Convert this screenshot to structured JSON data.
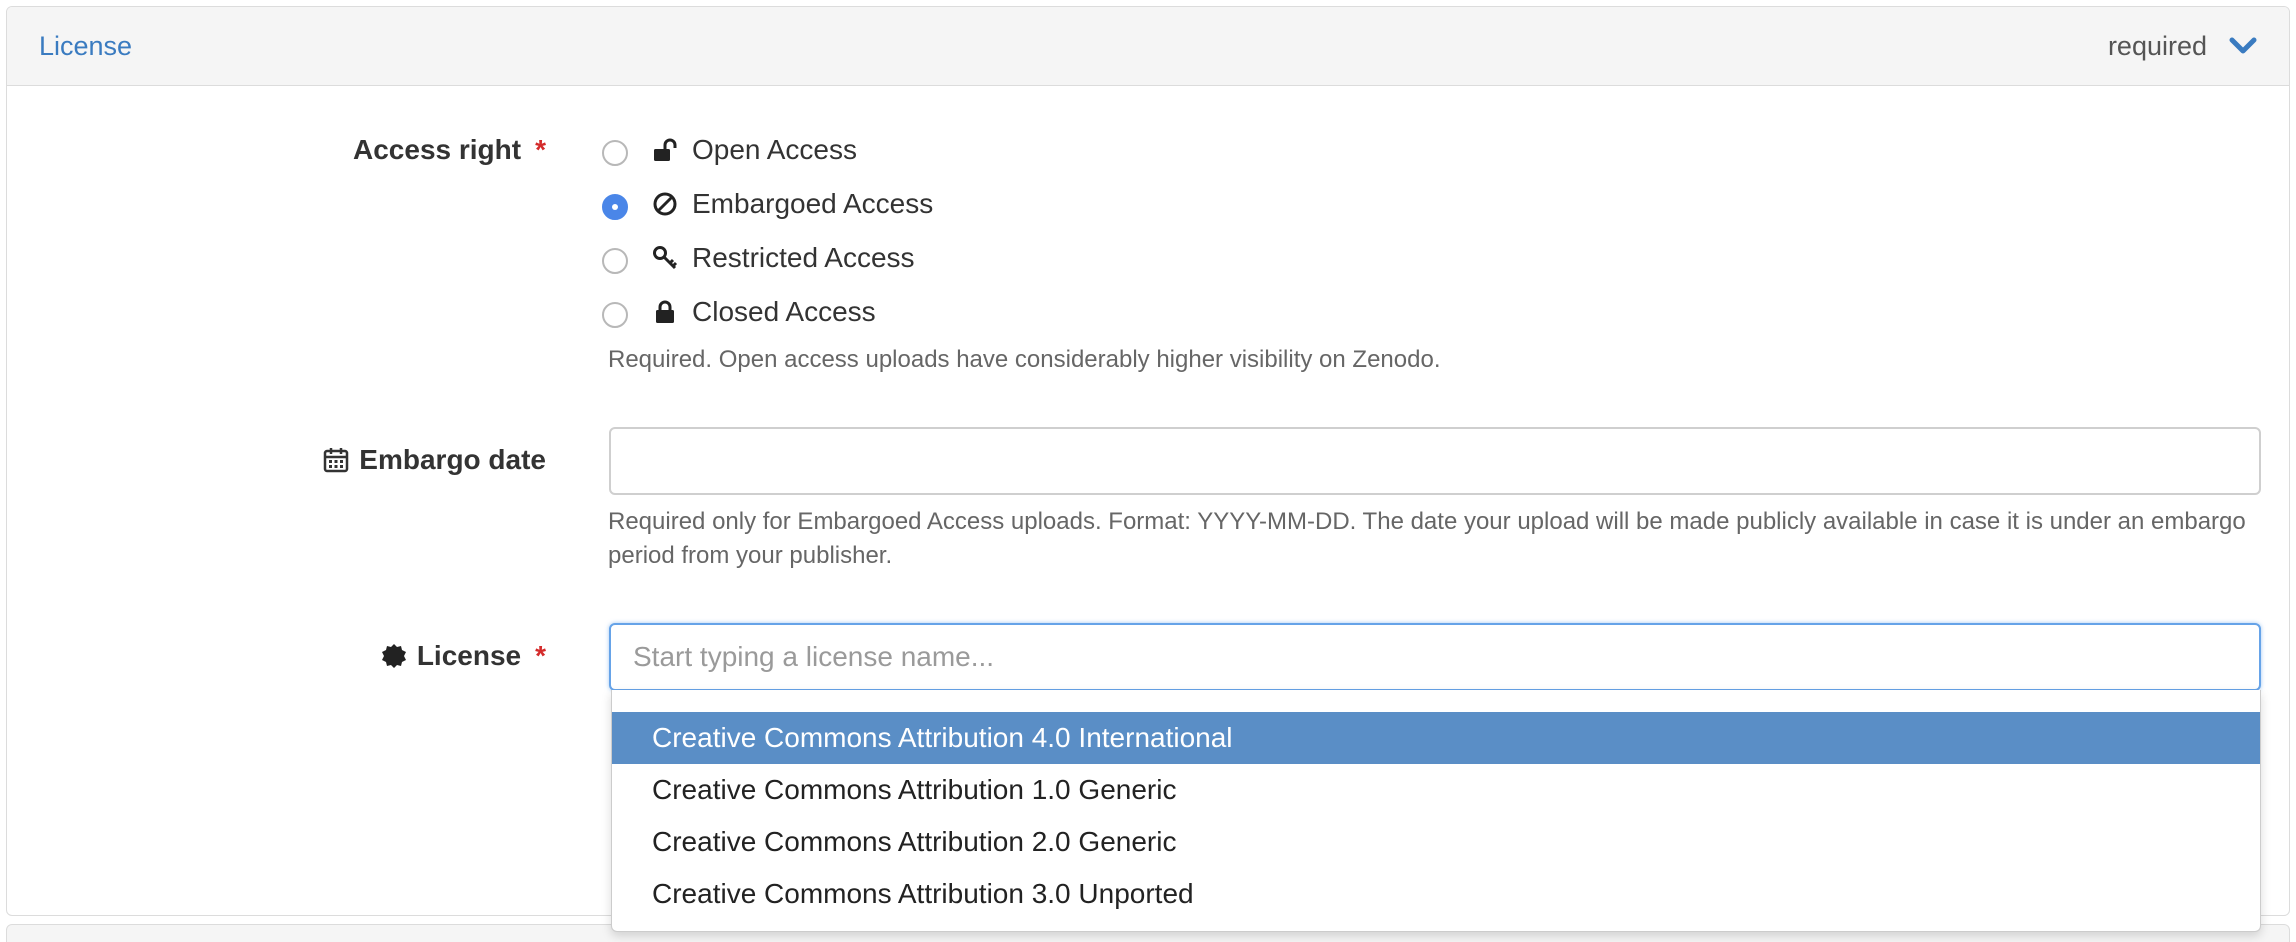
{
  "header": {
    "title": "License",
    "required_label": "required",
    "chevron_icon": "chevron-down-icon"
  },
  "access_right": {
    "label": "Access right",
    "required_mark": "*",
    "options": [
      {
        "label": "Open Access",
        "icon": "unlock-icon",
        "checked": false
      },
      {
        "label": "Embargoed Access",
        "icon": "ban-icon",
        "checked": true
      },
      {
        "label": "Restricted Access",
        "icon": "key-icon",
        "checked": false
      },
      {
        "label": "Closed Access",
        "icon": "lock-icon",
        "checked": false
      }
    ],
    "help": "Required. Open access uploads have considerably higher visibility on Zenodo."
  },
  "embargo": {
    "label": "Embargo date",
    "icon": "calendar-icon",
    "value": "",
    "help": "Required only for Embargoed Access uploads. Format: YYYY-MM-DD. The date your upload will be made publicly available in case it is under an embargo period from your publisher."
  },
  "license": {
    "label": "License",
    "icon": "certificate-icon",
    "required_mark": "*",
    "placeholder": "Start typing a license name...",
    "value": "",
    "suggestions": [
      {
        "label": "Creative Commons Attribution 4.0 International",
        "active": true
      },
      {
        "label": "Creative Commons Attribution 1.0 Generic",
        "active": false
      },
      {
        "label": "Creative Commons Attribution 2.0 Generic",
        "active": false
      },
      {
        "label": "Creative Commons Attribution 3.0 Unported",
        "active": false
      }
    ]
  },
  "colors": {
    "accent": "#3a7bc0",
    "required": "#d42b2b",
    "selected": "#5a8ec6",
    "radio_checked": "#4a86e8"
  }
}
